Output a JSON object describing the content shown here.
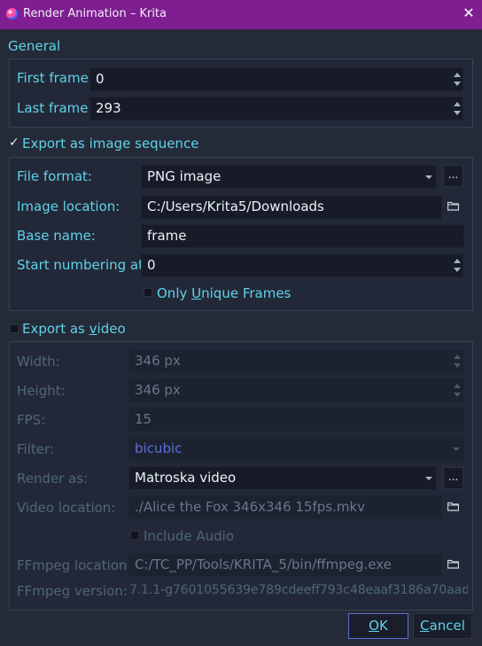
{
  "window": {
    "title": "Render Animation – Krita",
    "close_glyph": "✕"
  },
  "general": {
    "heading": "General",
    "first_frame_label": "First frame:",
    "first_frame_value": "0",
    "last_frame_label": "Last frame:",
    "last_frame_value": "293"
  },
  "image_sequence": {
    "checkbox_label": "Export as image sequence",
    "checked": true,
    "check_glyph": "✓",
    "file_format_label": "File format:",
    "file_format_value": "PNG image",
    "options_button": "...",
    "image_location_label": "Image location:",
    "image_location_value": "C:/Users/Krita5/Downloads",
    "base_name_label": "Base name:",
    "base_name_value": "frame",
    "start_numbering_label": "Start numbering at:",
    "start_numbering_value": "0",
    "only_unique_pre": "Only ",
    "only_unique_u": "U",
    "only_unique_post": "nique Frames"
  },
  "video": {
    "checkbox_pre": "Export as ",
    "checkbox_u": "v",
    "checkbox_post": "ideo",
    "checked": false,
    "width_label": "Width:",
    "width_value": "346 px",
    "height_label": "Height:",
    "height_value": "346 px",
    "fps_label": "FPS:",
    "fps_value": "15",
    "filter_label": "Filter:",
    "filter_value": "bicubic",
    "render_as_label": "Render as:",
    "render_as_value": "Matroska video",
    "options_button": "...",
    "video_location_label": "Video location:",
    "video_location_value": "./Alice the Fox 346x346 15fps.mkv",
    "include_audio_label": "Include Audio",
    "ffmpeg_location_label": "FFmpeg location:",
    "ffmpeg_location_value": "C:/TC_PP/Tools/KRITA_5/bin/ffmpeg.exe",
    "ffmpeg_version_label": "FFmpeg version:",
    "ffmpeg_version_value": "7.1.1-g7601055639e789cdeeff793c48eaaf3186a70aad"
  },
  "buttons": {
    "ok_u": "O",
    "ok_rest": "K",
    "cancel_u": "C",
    "cancel_rest": "ancel"
  },
  "colors": {
    "titlebar": "#7e1e91",
    "accent_text": "#5ed3e8",
    "background": "#252a38"
  }
}
